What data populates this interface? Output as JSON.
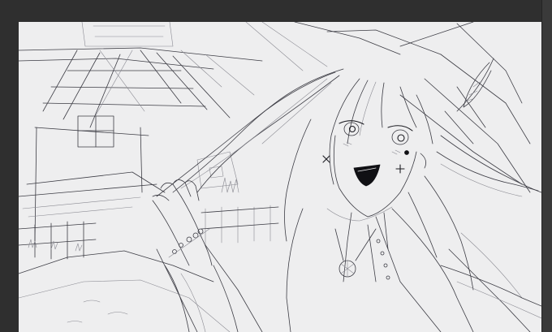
{
  "colors": {
    "workspace_bg": "#2f2f2f",
    "canvas_bg": "#eeeeef",
    "line_color": "#3c3c44"
  },
  "canvas": {
    "content": "sketch"
  }
}
